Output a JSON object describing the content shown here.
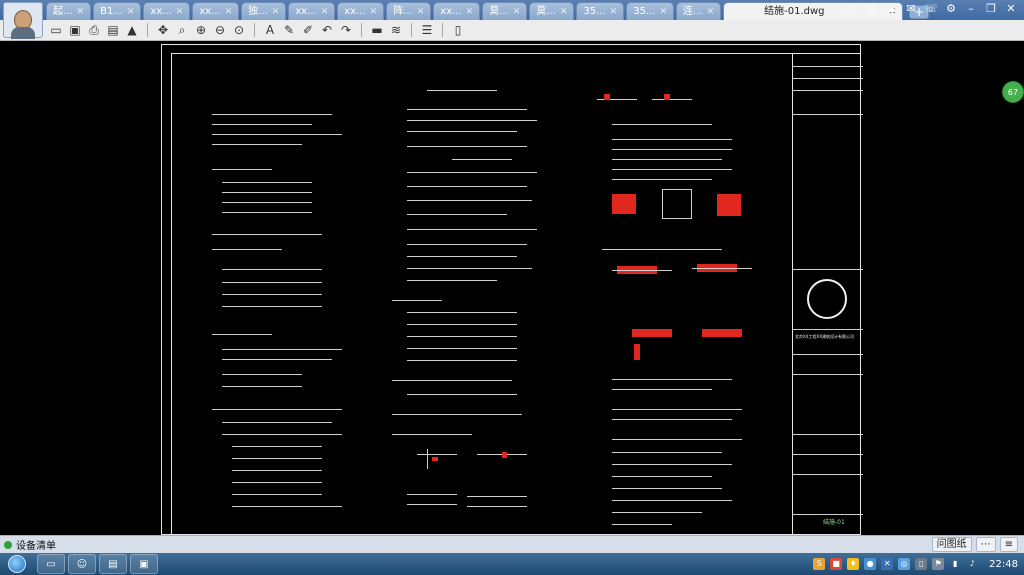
{
  "tabs": [
    {
      "label": "起..."
    },
    {
      "label": "B1..."
    },
    {
      "label": "xx..."
    },
    {
      "label": "xx..."
    },
    {
      "label": "独..."
    },
    {
      "label": "xx..."
    },
    {
      "label": "xx..."
    },
    {
      "label": "阵..."
    },
    {
      "label": "xx..."
    },
    {
      "label": "莫..."
    },
    {
      "label": "莫..."
    },
    {
      "label": "35..."
    },
    {
      "label": "35..."
    },
    {
      "label": "连..."
    }
  ],
  "active_tab": {
    "label": "结施-01.dwg"
  },
  "drawing": {
    "title_block_number": "结施-01",
    "company": "北京XX工程XX建筑设计有限公司",
    "badge": "67"
  },
  "status": {
    "device_list": "设备清单",
    "ask": "问图纸",
    "comment": "⋯"
  },
  "taskbar": {
    "clock": "22:48"
  }
}
